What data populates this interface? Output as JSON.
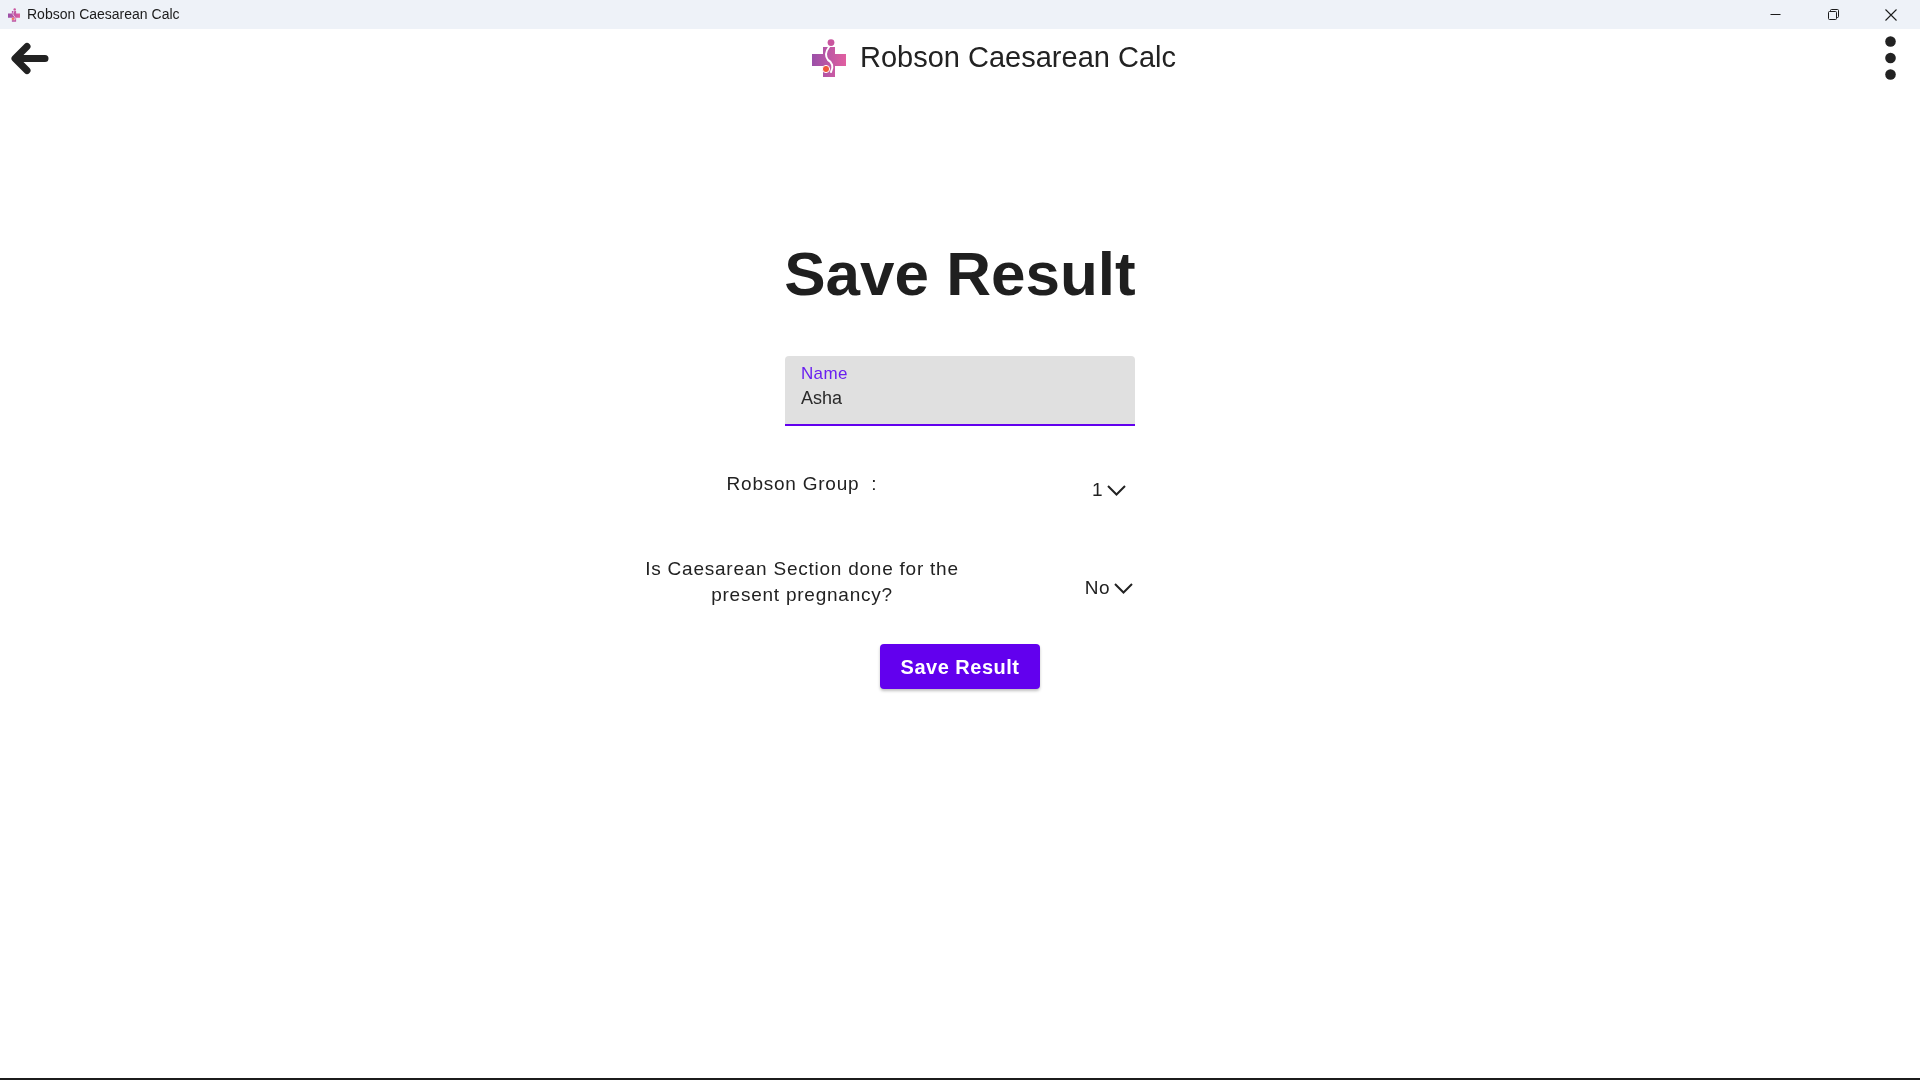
{
  "window": {
    "title": "Robson Caesarean Calc"
  },
  "app_bar": {
    "title": "Robson Caesarean Calc"
  },
  "heading": "Save Result",
  "name_field": {
    "label": "Name",
    "value": "Asha",
    "focused": true
  },
  "questions": [
    {
      "label": "Robson Group  :",
      "value": "1"
    },
    {
      "label": "Is Caesarean Section done for the present pregnancy?",
      "value": "No"
    }
  ],
  "save_button": {
    "label": "Save Result"
  }
}
